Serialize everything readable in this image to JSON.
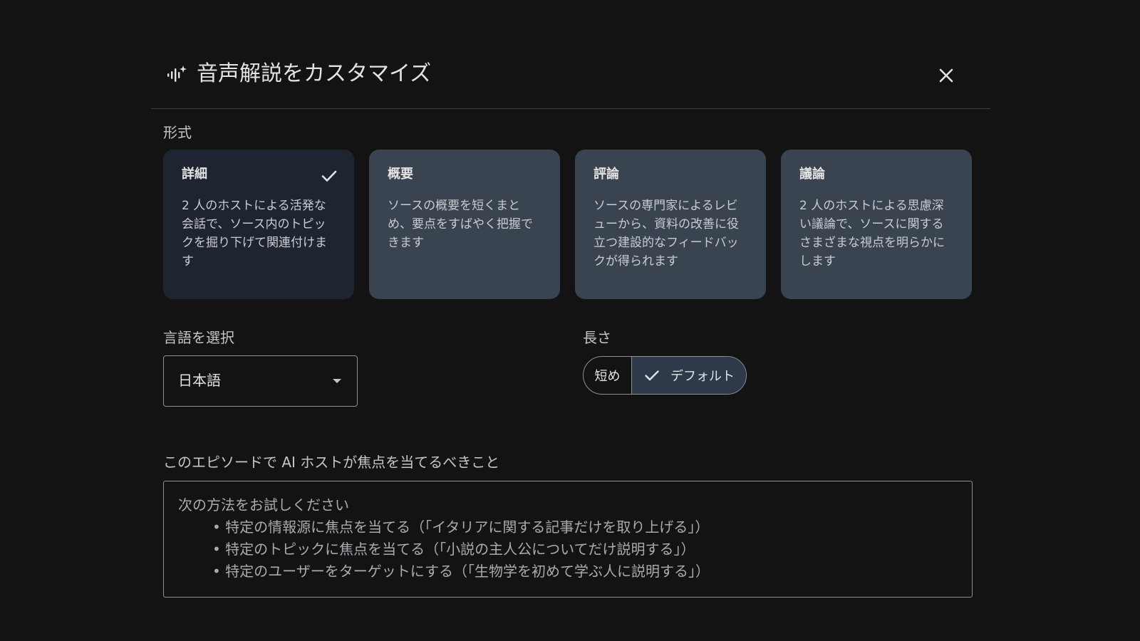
{
  "dialog": {
    "title": "音声解説をカスタマイズ",
    "header_icon": "audio-sparkle-icon",
    "close_icon": "close-icon"
  },
  "format": {
    "label": "形式",
    "cards": [
      {
        "title": "詳細",
        "description": "2 人のホストによる活発な会話で、ソース内のトピックを掘り下げて関連付けます",
        "selected": true
      },
      {
        "title": "概要",
        "description": "ソースの概要を短くまとめ、要点をすばやく把握できます",
        "selected": false
      },
      {
        "title": "評論",
        "description": "ソースの専門家によるレビューから、資料の改善に役立つ建設的なフィードバックが得られます",
        "selected": false
      },
      {
        "title": "議論",
        "description": "2 人のホストによる思慮深い議論で、ソースに関するさまざまな視点を明らかにします",
        "selected": false
      }
    ]
  },
  "language": {
    "label": "言語を選択",
    "selected": "日本語"
  },
  "length": {
    "label": "長さ",
    "options": [
      {
        "label": "短め",
        "selected": false
      },
      {
        "label": "デフォルト",
        "selected": true
      }
    ]
  },
  "focus": {
    "label": "このエピソードで AI ホストが焦点を当てるべきこと",
    "placeholder_intro": "次の方法をお試しください",
    "placeholder_items": [
      "• 特定の情報源に焦点を当てる（「イタリアに関する記事だけを取り上げる」）",
      "• 特定のトピックに焦点を当てる（「小説の主人公についてだけ説明する」）",
      "• 特定のユーザーをターゲットにする（「生物学を初めて学ぶ人に説明する」）"
    ]
  },
  "colors": {
    "background": "#131314",
    "card_selected": "#1f2530",
    "card_default": "#3a4350",
    "text_primary": "#e3e3e3"
  }
}
